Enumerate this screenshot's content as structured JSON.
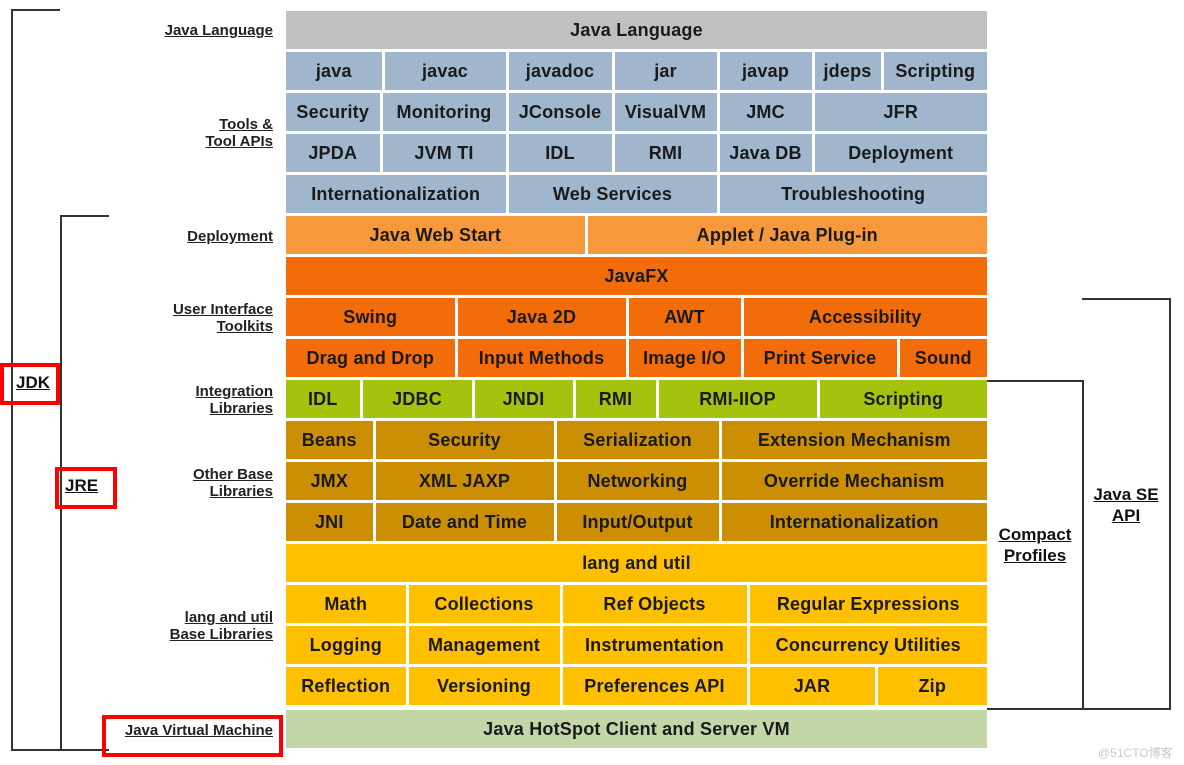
{
  "colors": {
    "java_language": "#c0c0c0",
    "tools": "#9fb6cd",
    "deployment": "#f7993a",
    "ui_toolkits": "#f26c0a",
    "integration": "#a5c20c",
    "other_base": "#cc8e02",
    "lang_util": "#ffc001",
    "jvm": "#c3d6a8",
    "highlight": "#ff0000"
  },
  "side_labels": {
    "java_language": "Java Language",
    "tools": [
      "Tools &",
      "Tool APIs"
    ],
    "deployment": "Deployment",
    "ui_toolkits": [
      "User Interface",
      "Toolkits"
    ],
    "integration": [
      "Integration",
      "Libraries"
    ],
    "other_base": [
      "Other Base",
      "Libraries"
    ],
    "lang_util": [
      "lang and util",
      "Base Libraries"
    ],
    "jvm": "Java Virtual Machine"
  },
  "brackets": {
    "jdk": "JDK",
    "jre": "JRE",
    "compact_profiles": [
      "Compact",
      "Profiles"
    ],
    "java_se_api": [
      "Java SE",
      "API"
    ]
  },
  "rows": {
    "java_language": [
      "Java Language"
    ],
    "tools_1": [
      "java",
      "javac",
      "javadoc",
      "jar",
      "javap",
      "jdeps",
      "Scripting"
    ],
    "tools_2": [
      "Security",
      "Monitoring",
      "JConsole",
      "VisualVM",
      "JMC",
      "JFR"
    ],
    "tools_3": [
      "JPDA",
      "JVM TI",
      "IDL",
      "RMI",
      "Java DB",
      "Deployment"
    ],
    "tools_4": [
      "Internationalization",
      "Web Services",
      "Troubleshooting"
    ],
    "deployment": [
      "Java Web Start",
      "Applet / Java Plug-in"
    ],
    "javafx": [
      "JavaFX"
    ],
    "ui_1": [
      "Swing",
      "Java 2D",
      "AWT",
      "Accessibility"
    ],
    "ui_2": [
      "Drag and Drop",
      "Input Methods",
      "Image I/O",
      "Print Service",
      "Sound"
    ],
    "integration": [
      "IDL",
      "JDBC",
      "JNDI",
      "RMI",
      "RMI-IIOP",
      "Scripting"
    ],
    "other_1": [
      "Beans",
      "Security",
      "Serialization",
      "Extension Mechanism"
    ],
    "other_2": [
      "JMX",
      "XML JAXP",
      "Networking",
      "Override Mechanism"
    ],
    "other_3": [
      "JNI",
      "Date and Time",
      "Input/Output",
      "Internationalization"
    ],
    "lang_util_header": [
      "lang and util"
    ],
    "lang_1": [
      "Math",
      "Collections",
      "Ref Objects",
      "Regular Expressions"
    ],
    "lang_2": [
      "Logging",
      "Management",
      "Instrumentation",
      "Concurrency Utilities"
    ],
    "lang_3": [
      "Reflection",
      "Versioning",
      "Preferences API",
      "JAR",
      "Zip"
    ],
    "jvm": [
      "Java HotSpot Client and Server VM"
    ]
  },
  "watermark": "@51CTO博客"
}
